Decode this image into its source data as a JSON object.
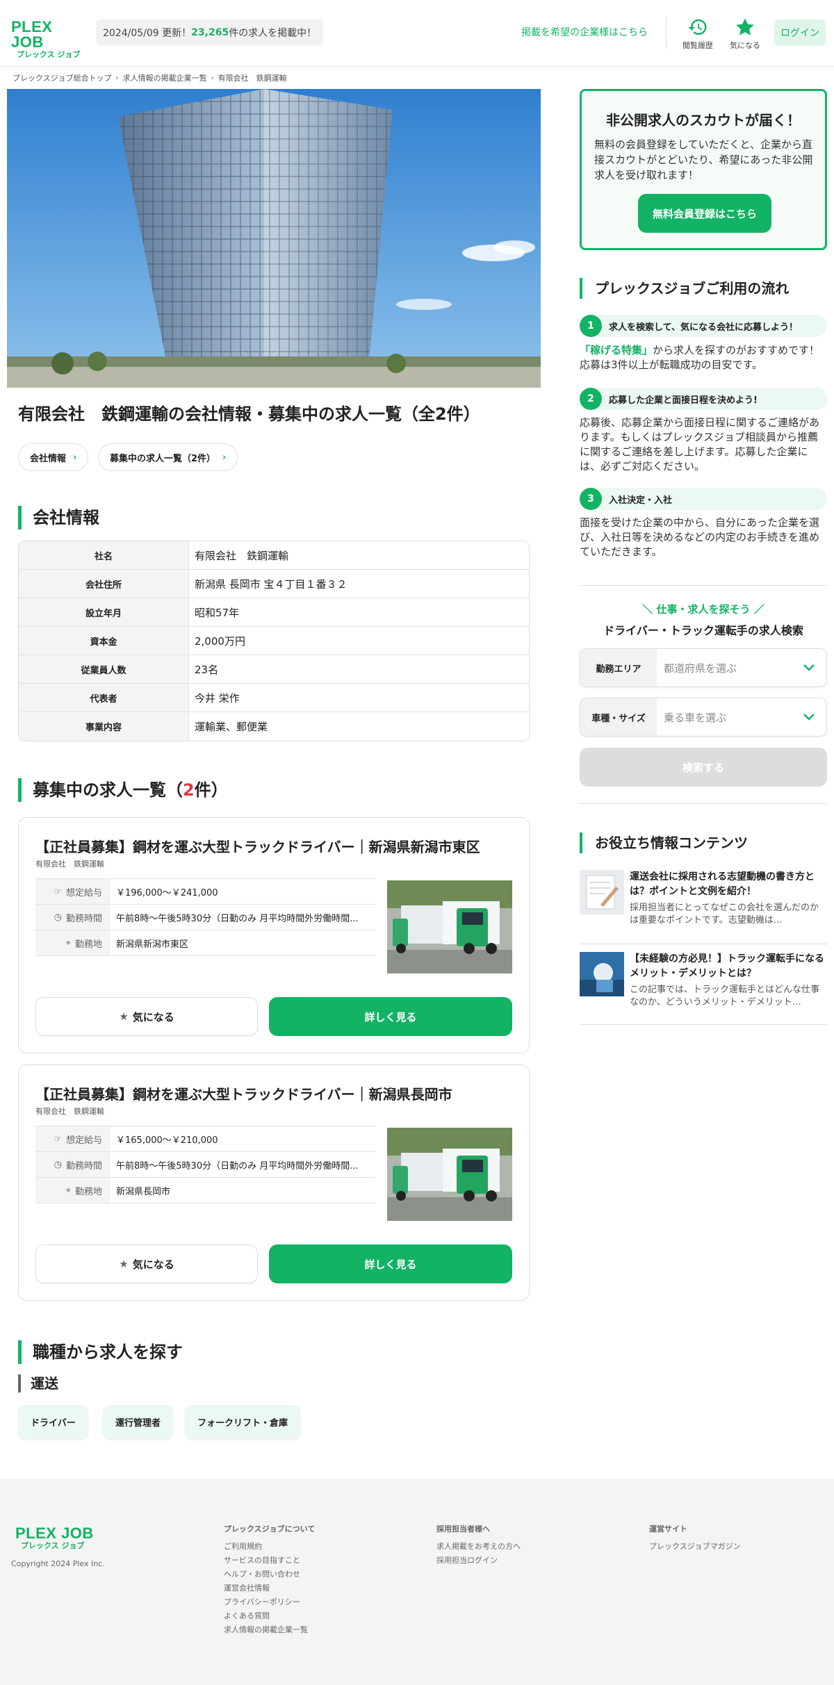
{
  "header": {
    "logo_main": "PLEX JOB",
    "logo_sub": "プレックス ジョブ",
    "update_date": "2024/05/09 更新！",
    "job_count": "23,265",
    "update_suffix": "件の求人を掲載中！",
    "recruiter_link": "掲載を希望の企業様はこちら",
    "history_label": "閲覧履歴",
    "favorites_label": "気になる",
    "login_label": "ログイン"
  },
  "breadcrumb": [
    "プレックスジョブ総合トップ",
    "求人情報の掲載企業一覧",
    "有限会社　鉄鋼運輸"
  ],
  "company_title": "有限会社　鉄鋼運輸の会社情報・募集中の求人一覧（全2件）",
  "anchors": [
    "会社情報",
    "募集中の求人一覧（2件）"
  ],
  "company_section": {
    "title": "会社情報",
    "rows": [
      {
        "label": "社名",
        "value": "有限会社　鉄鋼運輸"
      },
      {
        "label": "会社住所",
        "value": "新潟県 長岡市 宝４丁目１番３２"
      },
      {
        "label": "設立年月",
        "value": "昭和57年"
      },
      {
        "label": "資本金",
        "value": "2,000万円"
      },
      {
        "label": "従業員人数",
        "value": "23名"
      },
      {
        "label": "代表者",
        "value": "今井 栄作"
      },
      {
        "label": "事業内容",
        "value": "運輸業、郵便業"
      }
    ]
  },
  "jobs_section": {
    "title_prefix": "募集中の求人一覧（",
    "count": "2",
    "title_suffix": "件）"
  },
  "jobs": [
    {
      "title": "【正社員募集】鋼材を運ぶ大型トラックドライバー｜新潟県新潟市東区",
      "company": "有限会社　鉄鋼運輸",
      "salary_label": "想定給与",
      "salary": "￥196,000〜￥241,000",
      "hours_label": "勤務時間",
      "hours": "午前8時〜午後5時30分（日勤のみ 月平均時間外労働時間...",
      "location_label": "勤務地",
      "location": "新潟県新潟市東区",
      "fav_label": "気になる",
      "detail_label": "詳しく見る"
    },
    {
      "title": "【正社員募集】鋼材を運ぶ大型トラックドライバー｜新潟県長岡市",
      "company": "有限会社　鉄鋼運輸",
      "salary_label": "想定給与",
      "salary": "￥165,000〜￥210,000",
      "hours_label": "勤務時間",
      "hours": "午前8時〜午後5時30分（日勤のみ 月平均時間外労働時間...",
      "location_label": "勤務地",
      "location": "新潟県長岡市",
      "fav_label": "気になる",
      "detail_label": "詳しく見る"
    }
  ],
  "occupation_section": {
    "title": "職種から求人を探す",
    "subtitle": "運送",
    "tags": [
      "ドライバー",
      "運行管理者",
      "フォークリフト・倉庫"
    ]
  },
  "sidebar": {
    "scout": {
      "title": "非公開求人のスカウトが届く！",
      "text": "無料の会員登録をしていただくと、企業から直接スカウトがとどいたり、希望にあった非公開求人を受け取れます！",
      "button": "無料会員登録はこちら"
    },
    "flow_title": "プレックスジョブご利用の流れ",
    "steps": [
      {
        "num": "1",
        "title": "求人を検索して、気になる会社に応募しよう！",
        "link": "「稼げる特集」",
        "text": "から求人を探すのがおすすめです！応募は3件以上が転職成功の目安です。"
      },
      {
        "num": "2",
        "title": "応募した企業と面接日程を決めよう!",
        "text": "応募後、応募企業から面接日程に関するご連絡があります。もしくはプレックスジョブ相談員から推薦に関するご連絡を差し上げます。応募した企業には、必ずご対応ください。"
      },
      {
        "num": "3",
        "title": "入社決定・入社",
        "text": "面接を受けた企業の中から、自分にあった企業を選び、入社日等を決めるなどの内定のお手続きを進めていただきます。"
      }
    ],
    "search": {
      "kicker": "＼ 仕事・求人を探そう ／",
      "title": "ドライバー・トラック運転手の求人検索",
      "area_label": "勤務エリア",
      "area_placeholder": "都道府県を選ぶ",
      "vehicle_label": "車種・サイズ",
      "vehicle_placeholder": "乗る車を選ぶ",
      "button": "検索する"
    },
    "useful_title": "お役立ち情報コンテンツ",
    "articles": [
      {
        "title": "運送会社に採用される志望動機の書き方とは？ポイントと文例を紹介！",
        "desc": "採用担当者にとってなぜこの会社を選んだのかは重要なポイントです。志望動機は…"
      },
      {
        "title": "【未経験の方必見！】トラック運転手になるメリット・デメリットとは？",
        "desc": "この記事では、トラック運転手とはどんな仕事なのか、どういうメリット・デメリット…"
      }
    ]
  },
  "footer": {
    "copyright": "Copyright 2024 Plex Inc.",
    "col1_title": "プレックスジョブについて",
    "col1_items": [
      "ご利用規約",
      "サービスの目指すこと",
      "ヘルプ・お問い合わせ",
      "運営会社情報",
      "プライバシーポリシー",
      "よくある質問",
      "求人情報の掲載企業一覧"
    ],
    "col2_title": "採用担当者様へ",
    "col2_items": [
      "求人掲載をお考えの方へ",
      "採用担当ログイン"
    ],
    "col3_title": "運営サイト",
    "col3_items": [
      "プレックスジョブマガジン"
    ]
  },
  "colors": {
    "brand": "#12b364",
    "accent_red": "#e0393e"
  }
}
